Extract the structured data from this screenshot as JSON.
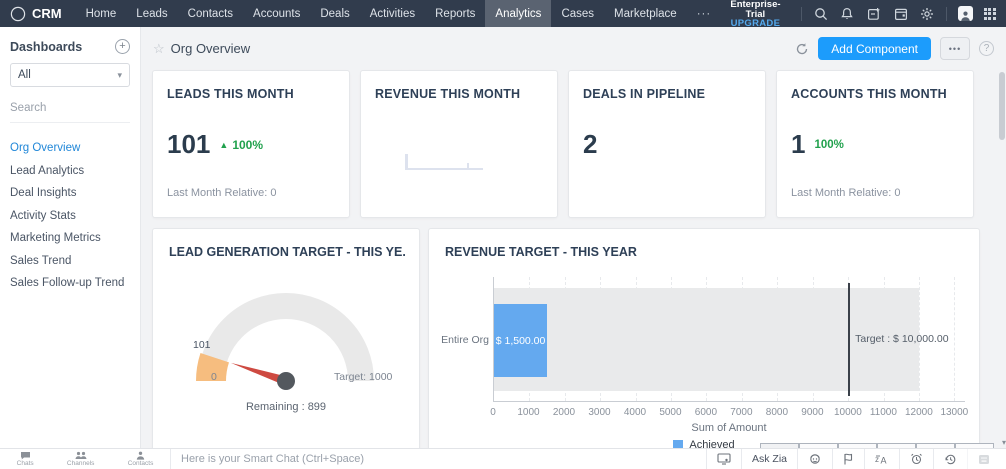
{
  "nav": {
    "brand": "CRM",
    "items": [
      "Home",
      "Leads",
      "Contacts",
      "Accounts",
      "Deals",
      "Activities",
      "Reports",
      "Analytics",
      "Cases",
      "Marketplace"
    ],
    "active_item": "Analytics",
    "overflow": "···",
    "trial": "Enterprise-Trial",
    "upgrade": "UPGRADE",
    "right_icons": [
      "search",
      "notifications",
      "compose",
      "calendar",
      "settings",
      "avatar",
      "app-grid"
    ]
  },
  "sidebar": {
    "title": "Dashboards",
    "filter_value": "All",
    "search_placeholder": "Search",
    "items": [
      "Org Overview",
      "Lead Analytics",
      "Deal Insights",
      "Activity Stats",
      "Marketing Metrics",
      "Sales Trend",
      "Sales Follow-up Trend"
    ],
    "active_item": "Org Overview"
  },
  "toolbar": {
    "title": "Org Overview",
    "add_component": "Add Component",
    "more": "•••",
    "help": "?"
  },
  "kpis": [
    {
      "title": "LEADS THIS MONTH",
      "value": "101",
      "delta": "100%",
      "delta_dir": "up",
      "footer": "Last Month Relative: 0"
    },
    {
      "title": "REVENUE THIS MONTH",
      "value": "",
      "empty_chart": true
    },
    {
      "title": "DEALS IN PIPELINE",
      "value": "2"
    },
    {
      "title": "ACCOUNTS THIS MONTH",
      "value": "1",
      "delta": "100%",
      "footer": "Last Month Relative: 0"
    }
  ],
  "chart_data": [
    {
      "type": "gauge",
      "title": "LEAD GENERATION TARGET - THIS YE...",
      "value": 101,
      "min": 0,
      "target": 1000,
      "value_label": "101",
      "min_label": "0",
      "target_label": "Target: 1000",
      "remaining_label": "Remaining : 899",
      "colors": {
        "arc": "#e9e9e9",
        "fill": "#f6bd7f",
        "needle": "#ce4a41",
        "hub": "#53585e"
      }
    },
    {
      "type": "bar",
      "orientation": "horizontal",
      "title": "REVENUE TARGET - THIS YEAR",
      "categories": [
        "Entire Org"
      ],
      "series": [
        {
          "name": "Achieved",
          "values": [
            1500
          ],
          "color": "#64a9ef"
        }
      ],
      "bar_value_label": "$ 1,500.00",
      "target": 10000,
      "target_label": "Target : $ 10,000.00",
      "track_max": 12000,
      "axis_max": 13300,
      "xticks": [
        0,
        1000,
        2000,
        3000,
        4000,
        5000,
        6000,
        7000,
        8000,
        9000,
        10000,
        11000,
        12000,
        13000
      ],
      "xlabel": "Sum of Amount",
      "legend": [
        "Achieved"
      ],
      "legend_position": "bottom",
      "grid": true
    }
  ],
  "chatbar": {
    "tabs": [
      "Chats",
      "Channels",
      "Contacts"
    ],
    "placeholder": "Here is your Smart Chat (Ctrl+Space)",
    "ask_zia": "Ask Zia",
    "right_icons": [
      "screen-share",
      "ask-zia",
      "zia-face",
      "flag",
      "translate",
      "alarm",
      "history",
      "keypad"
    ]
  }
}
